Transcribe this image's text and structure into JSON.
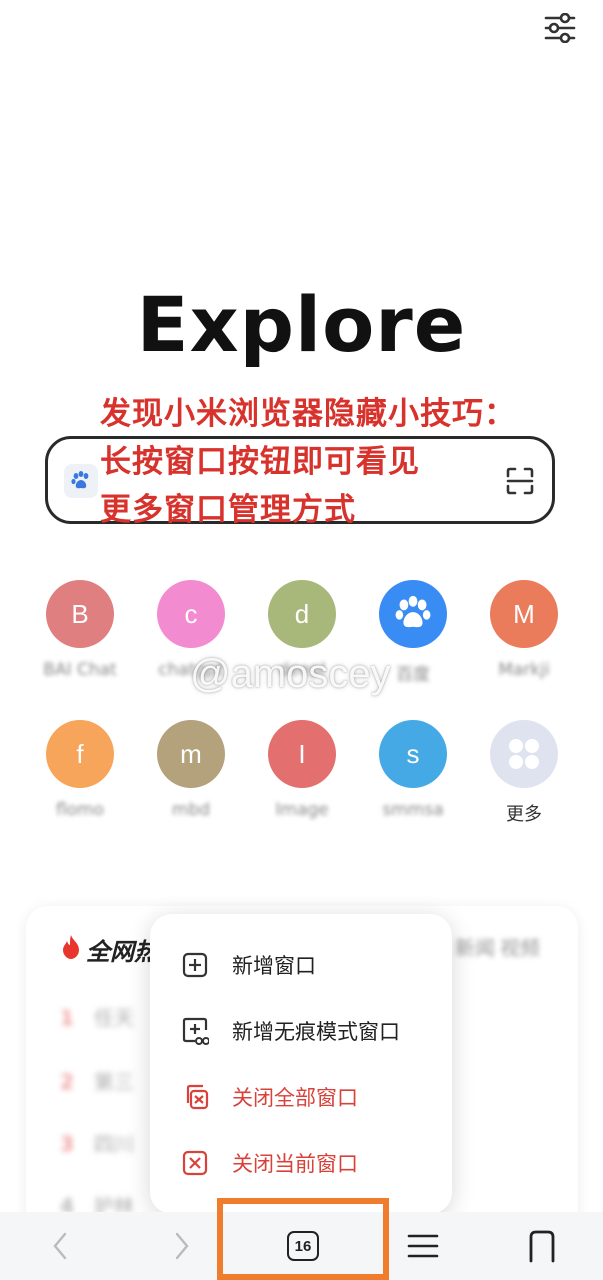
{
  "header": {
    "settings_icon": "sliders-icon"
  },
  "logo": {
    "text": "Explore"
  },
  "annotation": {
    "line1": "发现小米浏览器隐藏小技巧：",
    "line2": "长按窗口按钮即可看见",
    "line3": "更多窗口管理方式",
    "color": "#d8322c"
  },
  "search": {
    "left_icon": "baidu-paw-icon",
    "right_icon": "scan-icon"
  },
  "shortcuts": [
    {
      "letter": "B",
      "label": "BAI Chat",
      "color": "#e07f7f"
    },
    {
      "letter": "c",
      "label": "chatgpt",
      "color": "#f28bd0"
    },
    {
      "letter": "d",
      "label": "deepl",
      "color": "#a8b87a"
    },
    {
      "letter": "",
      "label": "百度",
      "color": "#3a8cf5"
    },
    {
      "letter": "M",
      "label": "Markji",
      "color": "#ea7b5b"
    },
    {
      "letter": "f",
      "label": "flomo",
      "color": "#f6a55a"
    },
    {
      "letter": "m",
      "label": "mbd",
      "color": "#b4a27c"
    },
    {
      "letter": "I",
      "label": "Image",
      "color": "#e36f6f"
    },
    {
      "letter": "s",
      "label": "smmsa",
      "color": "#45a9e6"
    },
    {
      "letter": "",
      "label": "更多",
      "color": "#dfe3ef"
    }
  ],
  "watermark": "@amoscey",
  "hot": {
    "title": "全网热",
    "tabs": [
      "新闻",
      "视频"
    ],
    "rows": [
      {
        "num": "1",
        "text": "任天"
      },
      {
        "num": "2",
        "text": "第三"
      },
      {
        "num": "3",
        "text": "四川"
      },
      {
        "num": "4",
        "text": "护林"
      }
    ]
  },
  "menu": {
    "items": [
      {
        "label": "新增窗口",
        "icon": "plus-square-icon",
        "style": "dark"
      },
      {
        "label": "新增无痕模式窗口",
        "icon": "incognito-add-icon",
        "style": "dark"
      },
      {
        "label": "关闭全部窗口",
        "icon": "close-all-windows-icon",
        "style": "red"
      },
      {
        "label": "关闭当前窗口",
        "icon": "close-window-icon",
        "style": "red"
      }
    ]
  },
  "bottom": {
    "tab_count": "16",
    "highlight_color": "#f07c2e"
  }
}
